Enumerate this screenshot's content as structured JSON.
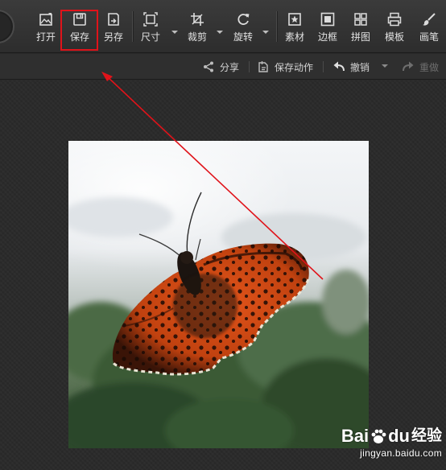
{
  "toolbar": {
    "items": [
      {
        "label": "打开",
        "icon": "open-icon"
      },
      {
        "label": "保存",
        "icon": "save-icon"
      },
      {
        "label": "另存",
        "icon": "save-as-icon"
      },
      {
        "label": "尺寸",
        "icon": "resize-icon"
      },
      {
        "label": "裁剪",
        "icon": "crop-icon"
      },
      {
        "label": "旋转",
        "icon": "rotate-icon"
      },
      {
        "label": "素材",
        "icon": "material-icon"
      },
      {
        "label": "边框",
        "icon": "border-icon"
      },
      {
        "label": "拼图",
        "icon": "collage-icon"
      },
      {
        "label": "模板",
        "icon": "template-icon"
      },
      {
        "label": "画笔",
        "icon": "brush-icon"
      }
    ],
    "highlight_color": "#e0131a"
  },
  "subbar": {
    "share": "分享",
    "save_action": "保存动作",
    "undo": "撤销",
    "redo": "重做"
  },
  "annotation": {
    "arrow_color": "#e0131a"
  },
  "watermark": {
    "brand_a": "Bai",
    "brand_b": "du",
    "product": "经验",
    "url": "jingyan.baidu.com"
  }
}
